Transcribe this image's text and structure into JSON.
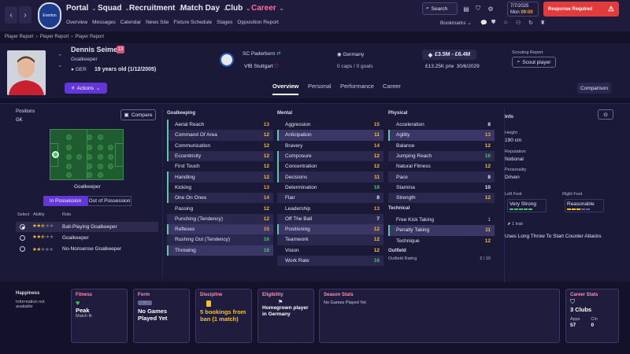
{
  "topbar": {
    "crest_text": "Everton",
    "menus": [
      {
        "label": "Portal"
      },
      {
        "label": "Squad"
      },
      {
        "label": "Recruitment"
      },
      {
        "label": "Match Day"
      },
      {
        "label": "Club"
      },
      {
        "label": "Career"
      }
    ],
    "submenu": [
      "Overview",
      "Messages",
      "Calendar",
      "News Site",
      "Fixture Schedule",
      "Stages",
      "Opposition Report"
    ],
    "search_label": "Search",
    "date": "7/7/2025",
    "day": "Mon",
    "time": "09:00",
    "response": "Response Required",
    "bookmarks": "Bookmarks"
  },
  "breadcrumb": [
    "Player Report",
    "Player Report",
    "Player Report"
  ],
  "player": {
    "name": "Dennis Seimen",
    "number": "13",
    "role": "Goalkeeper",
    "nation_code": "GER",
    "age": "19 years old (1/12/2005)",
    "actions": "Actions",
    "club": "SC Paderborn",
    "loan_club": "VfB Stuttgart",
    "country": "Germany",
    "caps": "0 caps / 0 goals",
    "value": "£3.5M - £6.4M",
    "wage": "£13.25K p/w",
    "contract": "30/6/2029",
    "scouting_label": "Scouting Report",
    "scout_btn": "Scout player"
  },
  "tabs": [
    {
      "label": "Overview",
      "active": true
    },
    {
      "label": "Personal"
    },
    {
      "label": "Performance"
    },
    {
      "label": "Career"
    }
  ],
  "comparison": "Comparison",
  "positions": {
    "title": "Positions",
    "code": "GK",
    "compare": "Compare",
    "pitch_label": "Goalkeeper",
    "toggle": [
      "In Possession",
      "Out of Possession"
    ],
    "cols": [
      "Select",
      "Ability",
      "Role"
    ],
    "roles": [
      {
        "name": "Ball-Playing Goalkeeper",
        "stars": 2.5,
        "selected": true
      },
      {
        "name": "Goalkeeper",
        "stars": 2.5
      },
      {
        "name": "No-Nonsense Goalkeeper",
        "stars": 2
      }
    ]
  },
  "goalkeeping": {
    "title": "Goalkeeping",
    "rows": [
      {
        "n": "Aerial Reach",
        "v": "13"
      },
      {
        "n": "Command Of Area",
        "v": "12"
      },
      {
        "n": "Communication",
        "v": "12"
      },
      {
        "n": "Eccentricity",
        "v": "12"
      },
      {
        "n": "First Touch",
        "v": "12"
      },
      {
        "n": "Handling",
        "v": "12"
      },
      {
        "n": "Kicking",
        "v": "13"
      },
      {
        "n": "One On Ones",
        "v": "14"
      },
      {
        "n": "Passing",
        "v": "12"
      },
      {
        "n": "Punching (Tendency)",
        "v": "12"
      },
      {
        "n": "Reflexes",
        "v": "15"
      },
      {
        "n": "Rushing Out (Tendency)",
        "v": "16"
      },
      {
        "n": "Throwing",
        "v": "18"
      }
    ]
  },
  "mental": {
    "title": "Mental",
    "rows": [
      {
        "n": "Aggression",
        "v": "15"
      },
      {
        "n": "Anticipation",
        "v": "11"
      },
      {
        "n": "Bravery",
        "v": "14"
      },
      {
        "n": "Composure",
        "v": "12"
      },
      {
        "n": "Concentration",
        "v": "12"
      },
      {
        "n": "Decisions",
        "v": "11"
      },
      {
        "n": "Determination",
        "v": "18"
      },
      {
        "n": "Flair",
        "v": "8"
      },
      {
        "n": "Leadership",
        "v": "13"
      },
      {
        "n": "Off The Ball",
        "v": "7"
      },
      {
        "n": "Positioning",
        "v": "12"
      },
      {
        "n": "Teamwork",
        "v": "12"
      },
      {
        "n": "Vision",
        "v": "12"
      },
      {
        "n": "Work Rate",
        "v": "16"
      }
    ]
  },
  "physical": {
    "title": "Physical",
    "rows": [
      {
        "n": "Acceleration",
        "v": "8"
      },
      {
        "n": "Agility",
        "v": "13"
      },
      {
        "n": "Balance",
        "v": "12"
      },
      {
        "n": "Jumping Reach",
        "v": "16"
      },
      {
        "n": "Natural Fitness",
        "v": "12"
      },
      {
        "n": "Pace",
        "v": "8"
      },
      {
        "n": "Stamina",
        "v": "10"
      },
      {
        "n": "Strength",
        "v": "12"
      }
    ]
  },
  "technical": {
    "title": "Technical",
    "rows": [
      {
        "n": "Free Kick Taking",
        "v": "1"
      },
      {
        "n": "Penalty Taking",
        "v": "11"
      },
      {
        "n": "Technique",
        "v": "12"
      }
    ]
  },
  "outfield": {
    "title": "Outfield",
    "label": "Outfield Rating",
    "value": "2 / 10"
  },
  "info": {
    "title": "Info",
    "height_lbl": "Height",
    "height": "190 cm",
    "rep_lbl": "Reputation",
    "rep": "Notional",
    "pers_lbl": "Personality",
    "pers": "Driven",
    "lf_lbl": "Left Foot",
    "lf": "Very Strong",
    "rf_lbl": "Right Foot",
    "rf": "Reasonable",
    "lf_level": 1,
    "rf_level": 0.6,
    "traits": "1 trait",
    "trait": "Uses Long Throw To Start Counter Attacks"
  },
  "cards": {
    "happiness": {
      "title": "Happiness",
      "text": "Information not available"
    },
    "fitness": {
      "title": "Fitness",
      "big": "Peak",
      "small": "Match fit"
    },
    "form": {
      "title": "Form",
      "big": "No Games Played Yet"
    },
    "discipline": {
      "title": "Discipline",
      "big": "5 bookings from ban (1 match)"
    },
    "eligibility": {
      "title": "Eligibility",
      "big": "Homegrown player in Germany"
    },
    "season": {
      "title": "Season Stats",
      "text": "No Games Played Yet"
    },
    "career": {
      "title": "Career Stats",
      "big": "3 Clubs",
      "apps_lbl": "Apps",
      "apps": "57",
      "cln_lbl": "Cln",
      "cln": "0"
    }
  },
  "colors": {
    "accent": "#6236d8",
    "response": "#e23b3b",
    "background": "#14122a"
  }
}
